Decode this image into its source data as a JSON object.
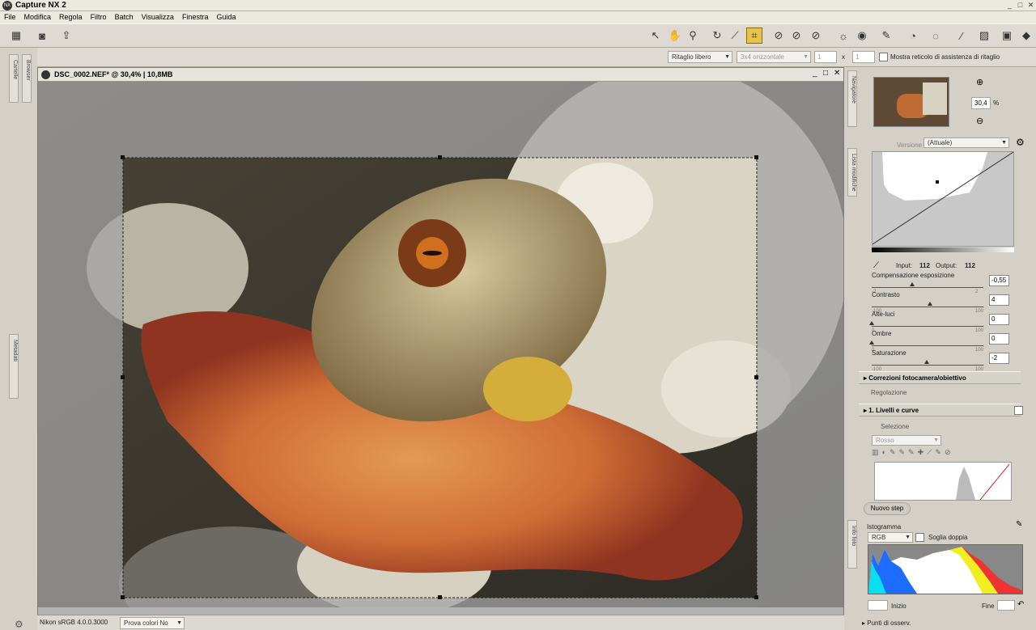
{
  "app": {
    "title": "Capture NX 2"
  },
  "menu": [
    "File",
    "Modifica",
    "Regola",
    "Filtro",
    "Batch",
    "Visualizza",
    "Finestra",
    "Guida"
  ],
  "crop_toolbar": {
    "ratio_select": "Ritaglio libero",
    "orientation_select": "3x4 orizzontale",
    "width_value": "1",
    "separator": "x",
    "height_value": "1",
    "grid_label": "Mostra reticolo di assistenza di ritaglio"
  },
  "left_tabs": {
    "cartelle": "Cartelle",
    "browser": "Browser",
    "metadati": "Metadati"
  },
  "document": {
    "title": "DSC_0002.NEF* @ 30,4% | 10,8MB"
  },
  "status": {
    "profile": "Nikon sRGB 4.0.0.3000",
    "proof": "Prova colori No"
  },
  "navigator": {
    "tab": "Navigatore",
    "zoom": "30,4",
    "zoom_unit": "%"
  },
  "edit_list": {
    "tab": "Lista modifiche",
    "version_label": "Versione",
    "version_value": "(Attuale)",
    "input_label": "Input:",
    "input_value": "112",
    "output_label": "Output:",
    "output_value": "112",
    "sliders": [
      {
        "label": "Compensazione esposizione",
        "min": "-2",
        "max": "2",
        "value": "-0,55",
        "pos": 0.36
      },
      {
        "label": "Contrasto",
        "min": "-100",
        "max": "100",
        "value": "4",
        "pos": 0.52
      },
      {
        "label": "Alte-luci",
        "min": "0",
        "max": "100",
        "value": "0",
        "pos": 0.0
      },
      {
        "label": "Ombre",
        "min": "0",
        "max": "100",
        "value": "0",
        "pos": 0.0
      },
      {
        "label": "Saturazione",
        "min": "-100",
        "max": "100",
        "value": "-2",
        "pos": 0.49
      }
    ],
    "correzioni": "Correzioni fotocamera/obiettivo",
    "regolazione": "Regolazione",
    "livelli": "1. Livelli e curve",
    "selezione": "Selezione",
    "channel": "Rosso",
    "nuovo_step": "Nuovo step"
  },
  "info": {
    "tab": "Info foto",
    "istogramma": "Istogramma",
    "channel": "RGB",
    "soglia": "Soglia doppia",
    "inizio": "Inizio",
    "fine": "Fine",
    "punti": "Punti di osserv."
  }
}
